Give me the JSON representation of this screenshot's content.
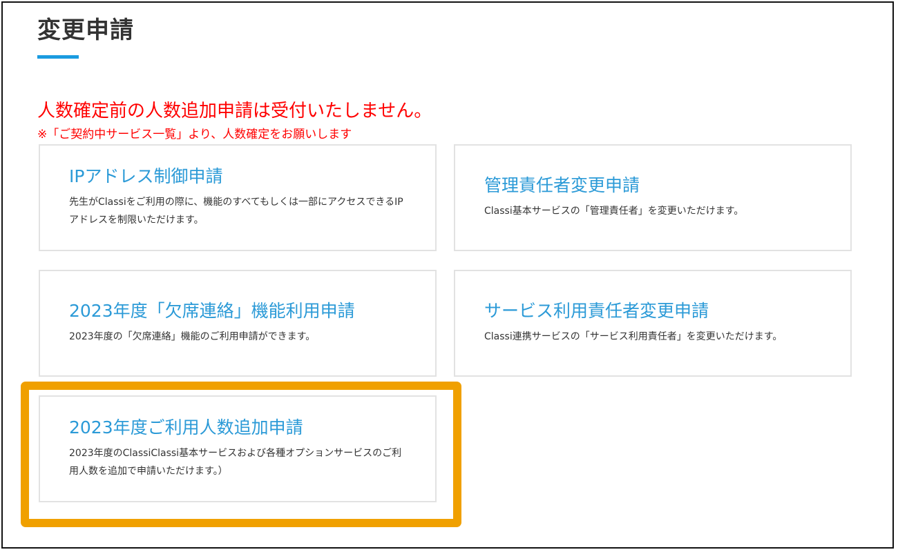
{
  "header": {
    "title": "変更申請"
  },
  "notice": {
    "main": "人数確定前の人数追加申請は受付いたしません。",
    "sub": "※「ご契約中サービス一覧」より、人数確定をお願いします"
  },
  "cards": [
    {
      "title": "IPアドレス制御申請",
      "description": "先生がClassiをご利用の際に、機能のすべてもしくは一部にアクセスできるIPアドレスを制限いただけます。"
    },
    {
      "title": "管理責任者変更申請",
      "description": "Classi基本サービスの「管理責任者」を変更いただけます。"
    },
    {
      "title": "2023年度「欠席連絡」機能利用申請",
      "description": "2023年度の「欠席連絡」機能のご利用申請ができます。"
    },
    {
      "title": "サービス利用責任者変更申請",
      "description": "Classi連携サービスの「サービス利用責任者」を変更いただけます。"
    },
    {
      "title": "2023年度ご利用人数追加申請",
      "description": "2023年度のClassiClassi基本サービスおよび各種オプションサービスのご利用人数を追加で申請いただけます。）"
    }
  ],
  "colors": {
    "accent_blue": "#2b9ad7",
    "underline_blue": "#1a9be0",
    "notice_red": "#ff0000",
    "highlight_orange": "#f0a000",
    "card_border": "#e2e2e2"
  }
}
